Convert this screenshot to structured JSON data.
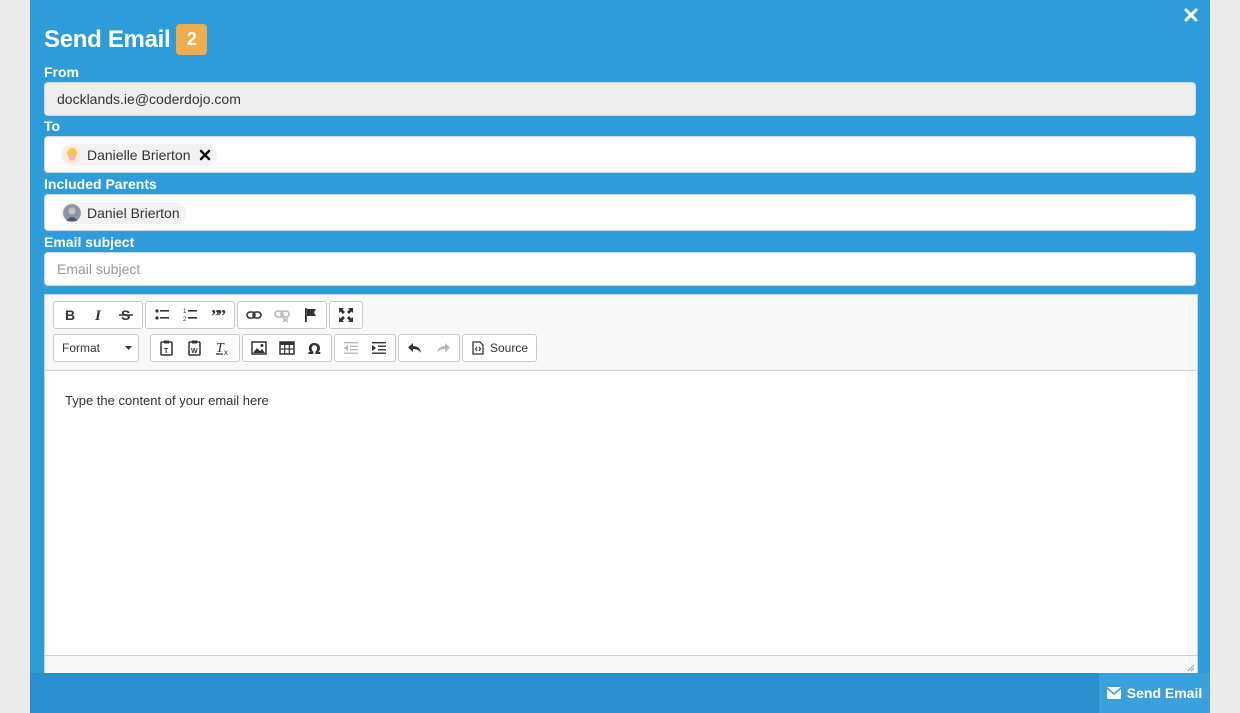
{
  "modal": {
    "title": "Send Email",
    "badge_count": "2"
  },
  "from": {
    "label": "From",
    "value": "docklands.ie@coderdojo.com"
  },
  "to": {
    "label": "To",
    "recipients": [
      {
        "name": "Danielle Brierton"
      }
    ]
  },
  "parents": {
    "label": "Included Parents",
    "items": [
      {
        "name": "Daniel Brierton"
      }
    ]
  },
  "subject": {
    "label": "Email subject",
    "placeholder": "Email subject"
  },
  "editor": {
    "format_label": "Format",
    "source_label": "Source",
    "content": "Type the content of your email here"
  },
  "footer": {
    "send_label": "Send Email"
  },
  "colors": {
    "modal_bg": "#2e9cd9",
    "badge": "#f0ad4e",
    "footer_bg": "#2b8fcf"
  }
}
